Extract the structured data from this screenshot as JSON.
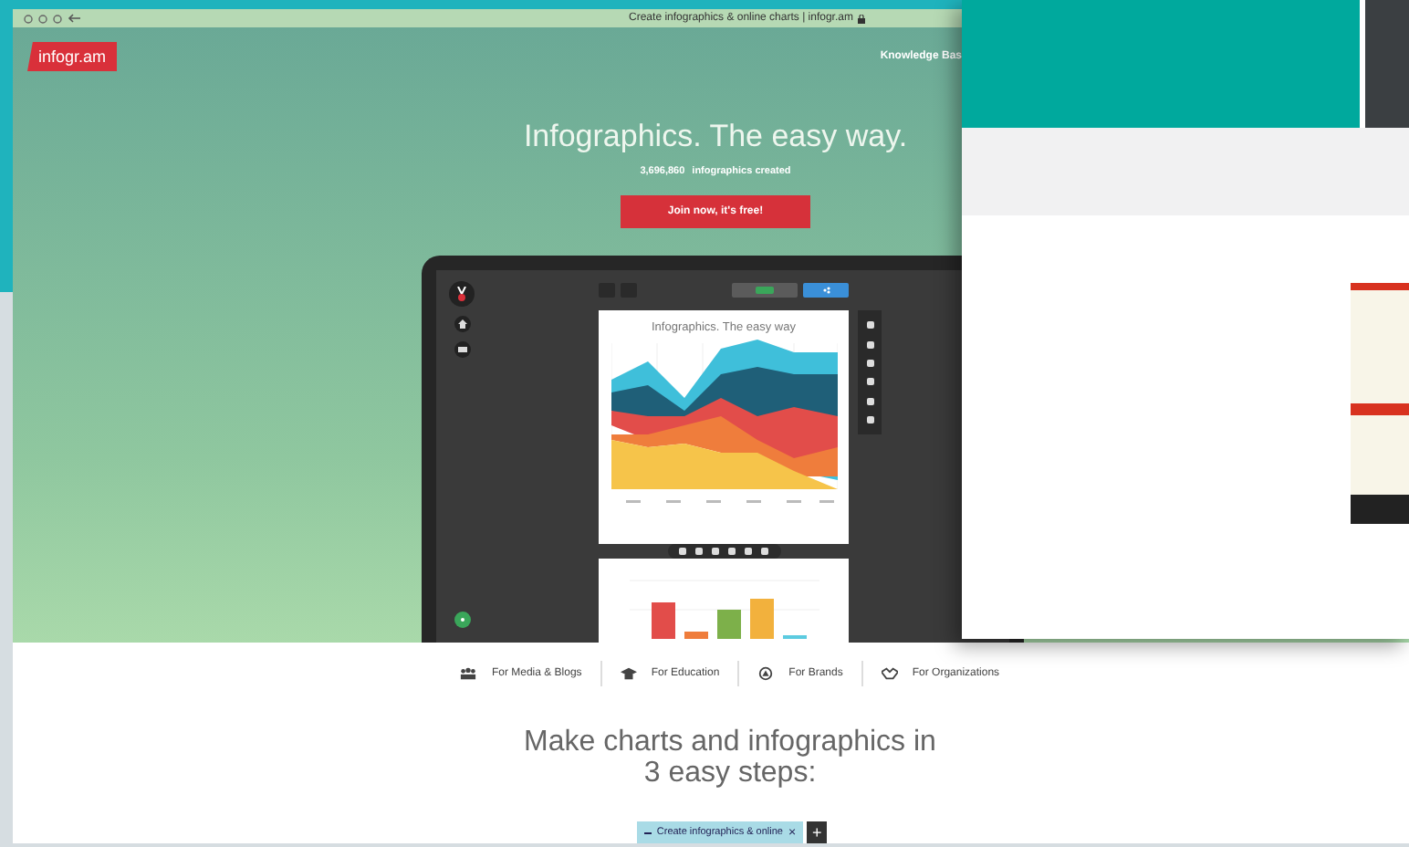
{
  "browser": {
    "title": "Create infographics & online charts | infogr.am"
  },
  "site": {
    "logo": "infogr.am",
    "nav_link": "Knowledge Bas",
    "headline": "Infographics. The easy way.",
    "counter": "3,696,860",
    "counter_label": "infographics created",
    "cta": "Join now, it's free!"
  },
  "editor": {
    "chart_title": "Infographics. The easy way"
  },
  "categories": [
    {
      "label": "For Media & Blogs"
    },
    {
      "label": "For Education"
    },
    {
      "label": "For Brands"
    },
    {
      "label": "For Organizations"
    }
  ],
  "steps_heading": "Make charts and infographics in 3 easy steps:",
  "tab_bar": {
    "tab": "Create infographics & online",
    "close": "×",
    "add": "+"
  }
}
